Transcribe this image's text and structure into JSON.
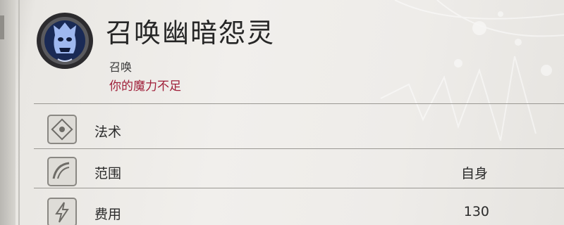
{
  "spell": {
    "name": "召唤幽暗怨灵",
    "school": "召唤",
    "warning": "你的魔力不足",
    "icon": "wraith-mask-icon"
  },
  "rows": [
    {
      "label": "法术",
      "value": "",
      "icon": "spell-rune-icon"
    },
    {
      "label": "范围",
      "value": "自身",
      "icon": "area-arc-icon"
    },
    {
      "label": "费用",
      "value": "130",
      "icon": "cost-bolt-icon"
    }
  ],
  "colors": {
    "warning": "#a0203a",
    "text": "#2b2b2b",
    "background": "#efedea"
  }
}
